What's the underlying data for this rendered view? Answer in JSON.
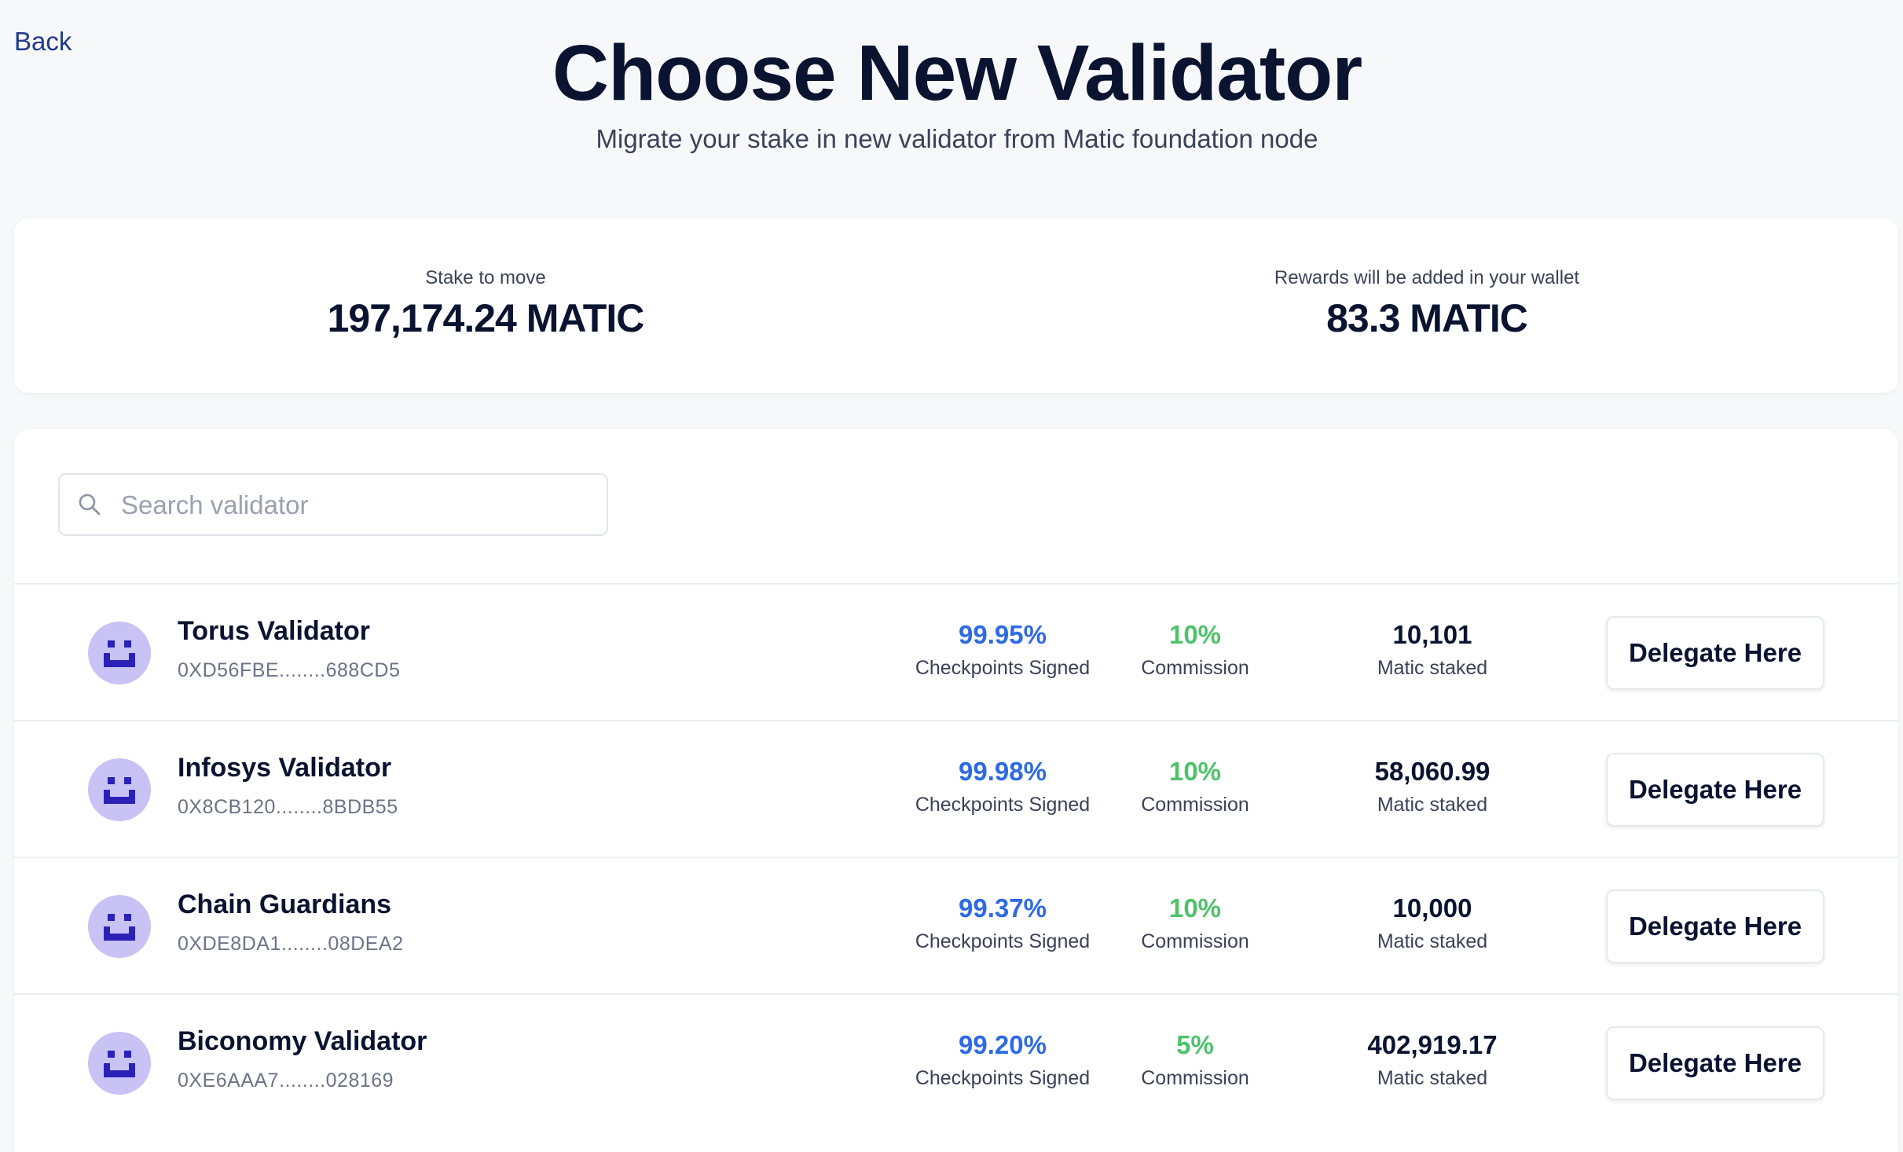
{
  "header": {
    "back_label": "Back",
    "title": "Choose New Validator",
    "subtitle": "Migrate your stake in new validator from Matic foundation node"
  },
  "stake_summary": {
    "stake_label": "Stake to move",
    "stake_value": "197,174.24 MATIC",
    "rewards_label": "Rewards will be added in your wallet",
    "rewards_value": "83.3 MATIC"
  },
  "search": {
    "placeholder": "Search validator",
    "value": ""
  },
  "icons": {
    "search": "search-icon",
    "avatar": "validator-avatar-icon"
  },
  "colors": {
    "checkpoints": "#2d6ae3",
    "commission": "#4ec26c",
    "avatar_bg": "#c9c2f5",
    "avatar_fg": "#2b21b8"
  },
  "validators": [
    {
      "name": "Torus Validator",
      "address": "0XD56FBE........688CD5",
      "checkpoints_signed": "99.95%",
      "checkpoints_label": "Checkpoints Signed",
      "commission": "10%",
      "commission_label": "Commission",
      "matic_staked": "10,101",
      "staked_label": "Matic staked",
      "button_label": "Delegate Here"
    },
    {
      "name": "Infosys Validator",
      "address": "0X8CB120........8BDB55",
      "checkpoints_signed": "99.98%",
      "checkpoints_label": "Checkpoints Signed",
      "commission": "10%",
      "commission_label": "Commission",
      "matic_staked": "58,060.99",
      "staked_label": "Matic staked",
      "button_label": "Delegate Here"
    },
    {
      "name": "Chain Guardians",
      "address": "0XDE8DA1........08DEA2",
      "checkpoints_signed": "99.37%",
      "checkpoints_label": "Checkpoints Signed",
      "commission": "10%",
      "commission_label": "Commission",
      "matic_staked": "10,000",
      "staked_label": "Matic staked",
      "button_label": "Delegate Here"
    },
    {
      "name": "Biconomy Validator",
      "address": "0XE6AAA7........028169",
      "checkpoints_signed": "99.20%",
      "checkpoints_label": "Checkpoints Signed",
      "commission": "5%",
      "commission_label": "Commission",
      "matic_staked": "402,919.17",
      "staked_label": "Matic staked",
      "button_label": "Delegate Here"
    }
  ]
}
